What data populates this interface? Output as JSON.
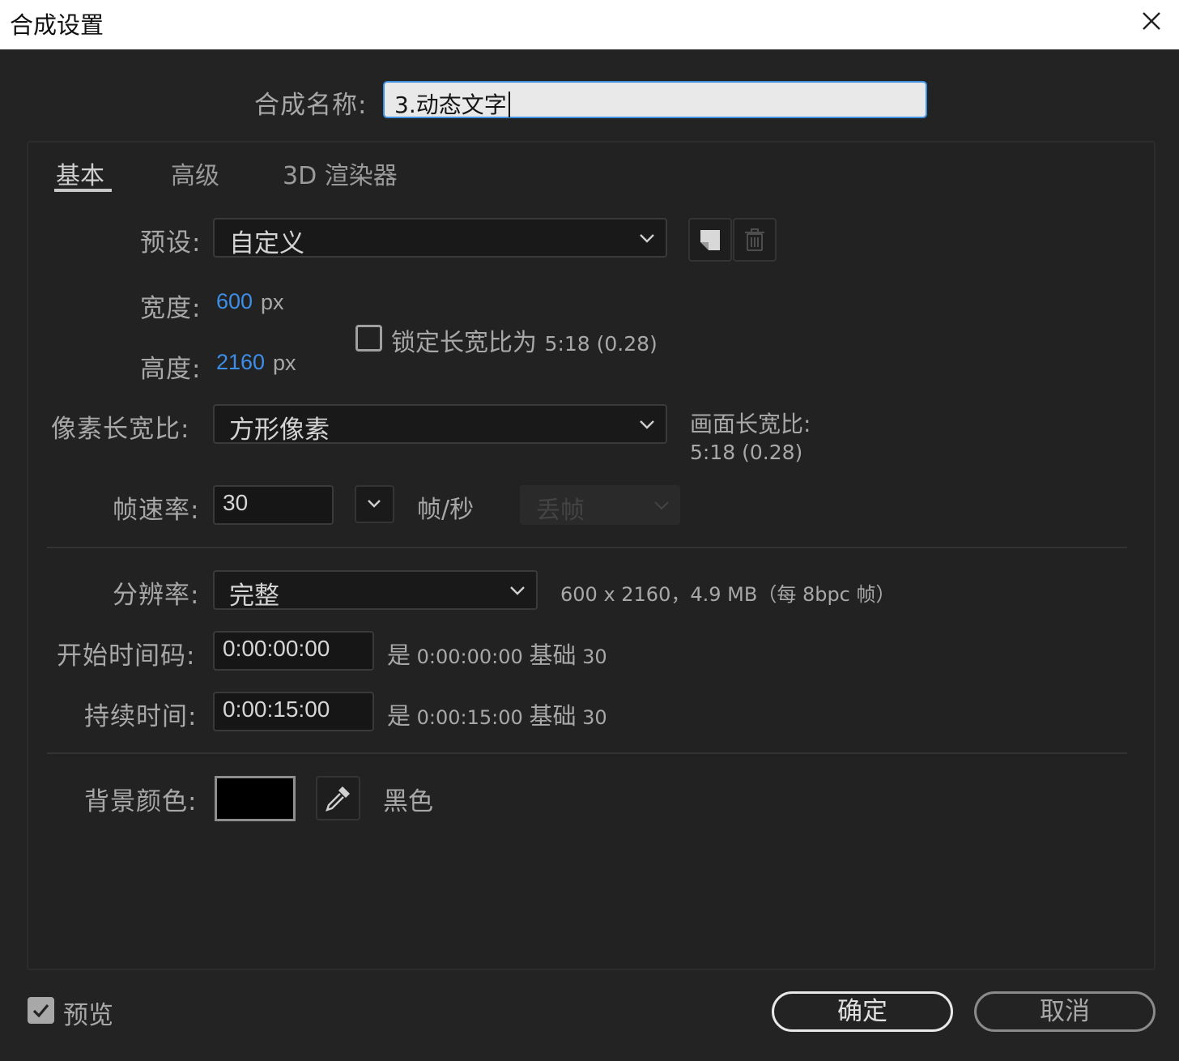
{
  "window": {
    "title": "合成设置"
  },
  "comp_name": {
    "label": "合成名称:",
    "value": "3.动态文字"
  },
  "tabs": [
    {
      "label": "基本",
      "active": true
    },
    {
      "label": "高级",
      "active": false
    },
    {
      "label": "3D 渲染器",
      "active": false
    }
  ],
  "preset": {
    "label": "预设:",
    "value": "自定义"
  },
  "width": {
    "label": "宽度:",
    "value": "600",
    "unit": "px"
  },
  "height": {
    "label": "高度:",
    "value": "2160",
    "unit": "px"
  },
  "lock_aspect": {
    "label": "锁定长宽比为",
    "ratio": "5:18 (0.28)",
    "checked": false
  },
  "pixel_aspect": {
    "label": "像素长宽比:",
    "value": "方形像素"
  },
  "frame_aspect": {
    "label": "画面长宽比:",
    "value": "5:18 (0.28)"
  },
  "frame_rate": {
    "label": "帧速率:",
    "value": "30",
    "unit": "帧/秒",
    "drop_frame": "丢帧"
  },
  "resolution": {
    "label": "分辨率:",
    "value": "完整",
    "info": "600 x 2160，4.9 MB（每 8bpc 帧）"
  },
  "start_timecode": {
    "label": "开始时间码:",
    "value": "0:00:00:00",
    "is_label": "是",
    "is_value": "0:00:00:00",
    "base_label": "基础",
    "base_value": "30"
  },
  "duration": {
    "label": "持续时间:",
    "value": "0:00:15:00",
    "is_label": "是",
    "is_value": "0:00:15:00",
    "base_label": "基础",
    "base_value": "30"
  },
  "background": {
    "label": "背景颜色:",
    "color": "#000000",
    "color_name": "黑色"
  },
  "preview": {
    "label": "预览",
    "checked": true
  },
  "buttons": {
    "ok": "确定",
    "cancel": "取消"
  },
  "colors": {
    "accent_blue": "#3d8ee8",
    "background": "#232323"
  }
}
